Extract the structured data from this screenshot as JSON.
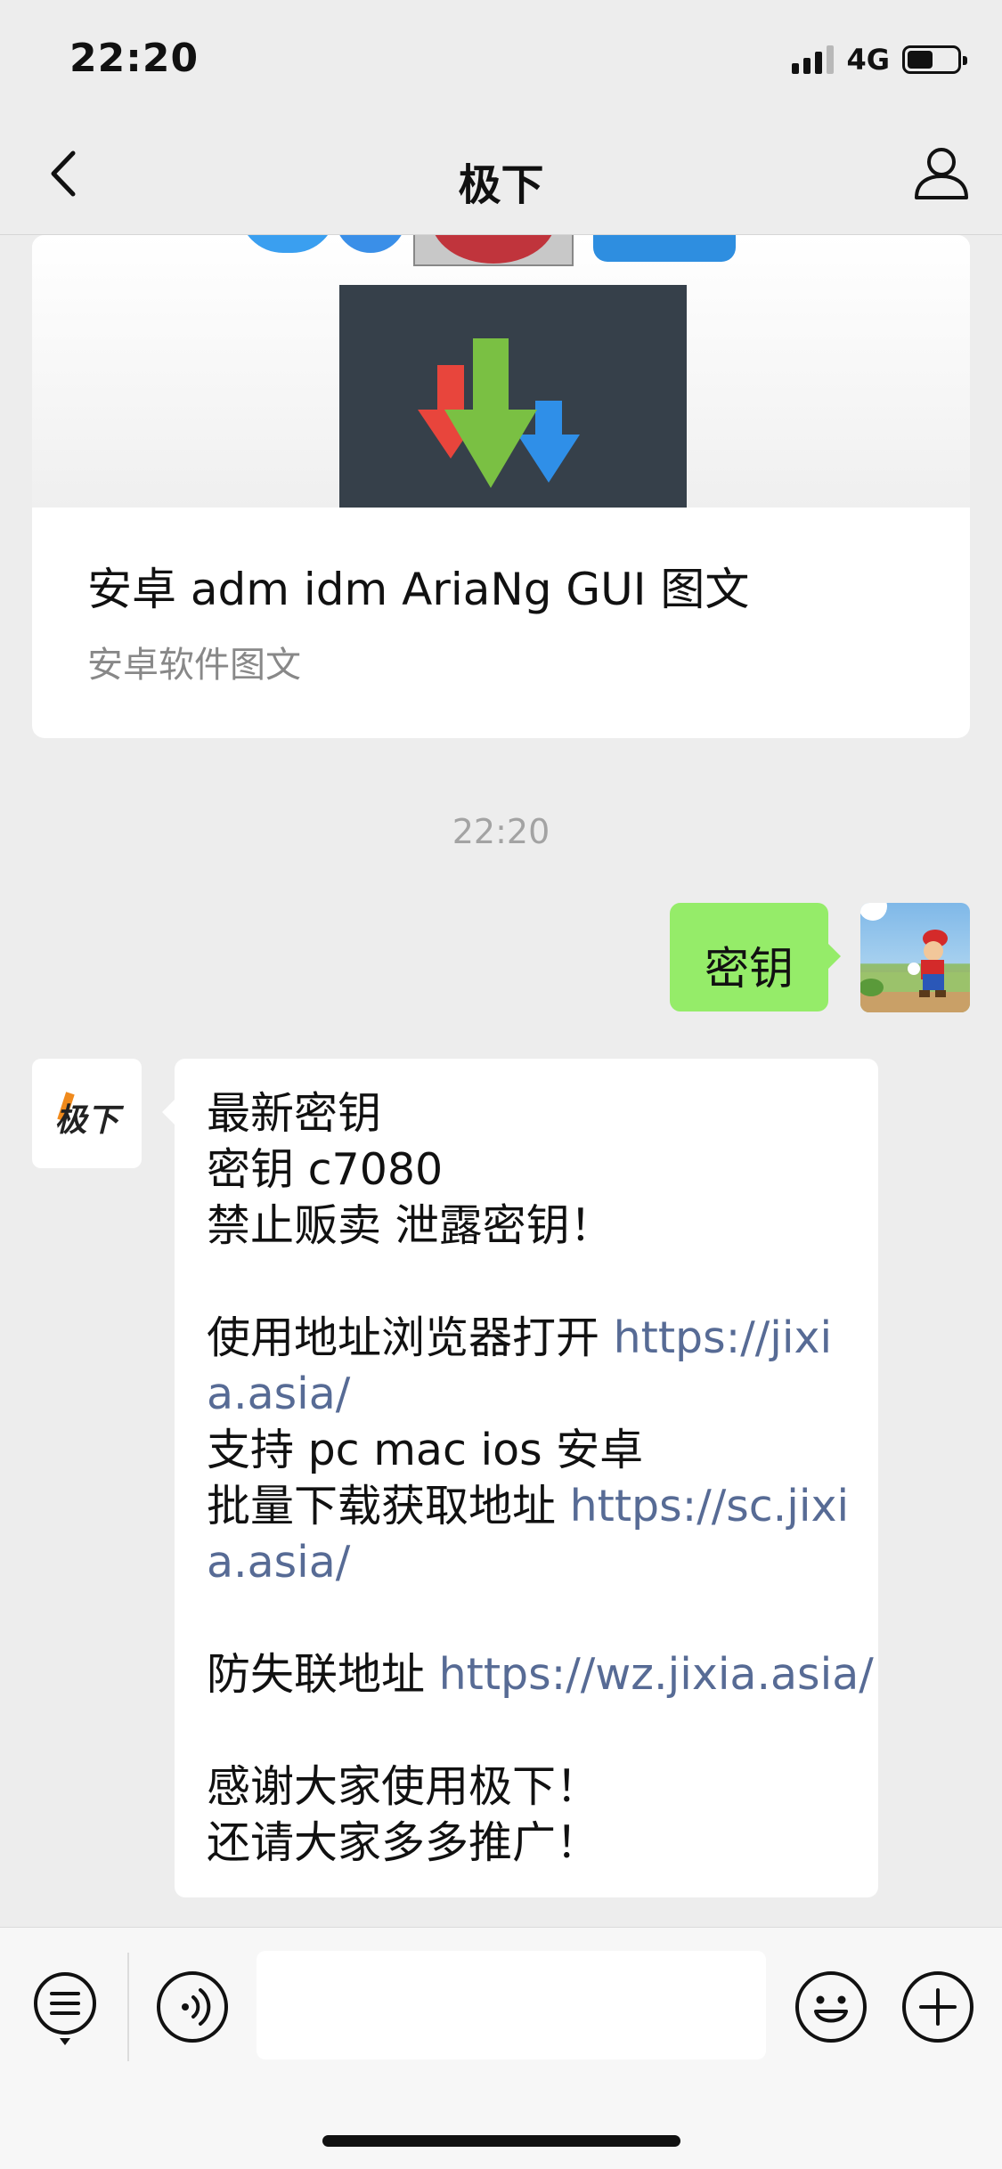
{
  "status_bar": {
    "time": "22:20",
    "network": "4G",
    "battery_level": 0.45,
    "signal_bars": 4,
    "signal_bars_active": 3
  },
  "header": {
    "title": "极下",
    "back_icon": "chevron-left-icon",
    "profile_icon": "person-icon"
  },
  "chat": {
    "article_card": {
      "title": "安卓 adm idm AriaNg GUI 图文",
      "subtitle": "安卓软件图文"
    },
    "timestamp": "22:20",
    "outgoing_message": {
      "text": "密钥"
    },
    "incoming_message": {
      "avatar_text": "极下",
      "line1": "最新密钥",
      "line2": "密钥 c7080",
      "line3": "禁止贩卖 泄露密钥！",
      "line4_text": "使用地址浏览器打开 ",
      "line4_link": "https://jixia.asia/",
      "line5": "支持 pc mac ios 安卓",
      "line6_text": "批量下载获取地址 ",
      "line6_link": "https://sc.jixia.asia/",
      "line7_text": "防失联地址 ",
      "line7_link": "https://wz.jixia.asia/",
      "line8": "感谢大家使用极下！",
      "line9": "还请大家多多推广！"
    }
  },
  "input_bar": {
    "menu_icon": "menu-list-icon",
    "voice_icon": "voice-icon",
    "input_value": "",
    "emoji_icon": "emoji-icon",
    "plus_icon": "plus-icon"
  },
  "colors": {
    "background": "#ededed",
    "outgoing_bubble": "#95ec69",
    "incoming_bubble": "#ffffff",
    "link": "#576b95",
    "timestamp": "#a3a3a3"
  }
}
